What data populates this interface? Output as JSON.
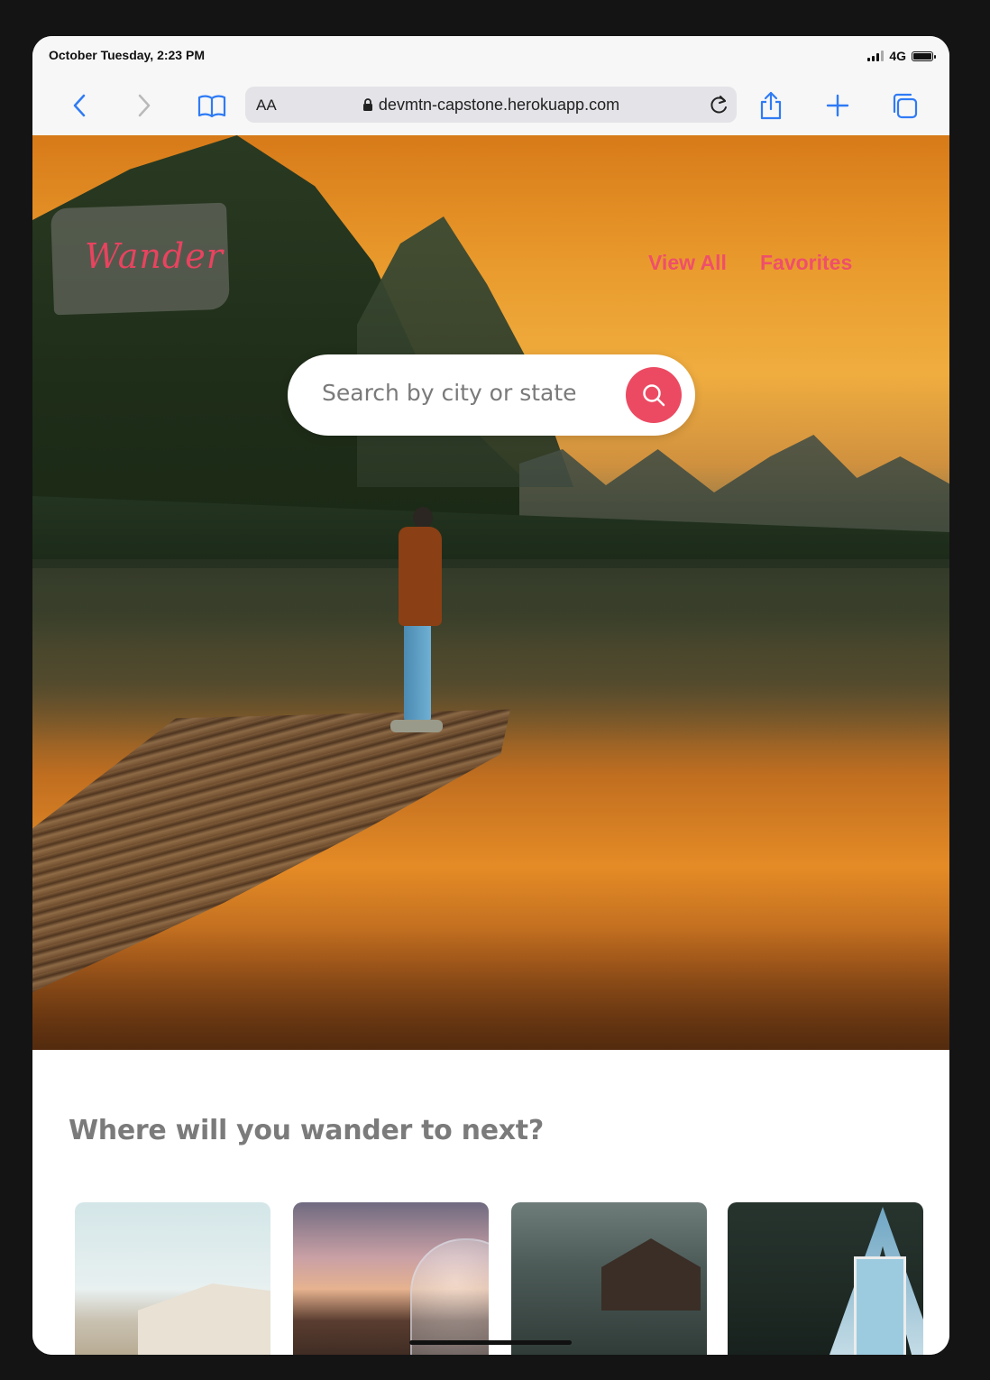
{
  "status_bar": {
    "time": "October Tuesday, 2:23 PM",
    "network": "4G"
  },
  "browser": {
    "text_size_label": "AA",
    "url": "devmtn-capstone.herokuapp.com",
    "icons": [
      "back-icon",
      "forward-icon",
      "bookmarks-icon",
      "lock-icon",
      "reload-icon",
      "share-icon",
      "new-tab-icon",
      "tabs-icon"
    ]
  },
  "site": {
    "brand": "Wander",
    "nav": {
      "view_all": "View All",
      "favorites": "Favorites"
    },
    "search": {
      "placeholder": "Search by city or state",
      "value": ""
    },
    "section_heading": "Where will you wander to next?"
  },
  "colors": {
    "accent": "#ec4a62",
    "ios_blue": "#2f7bf5"
  }
}
